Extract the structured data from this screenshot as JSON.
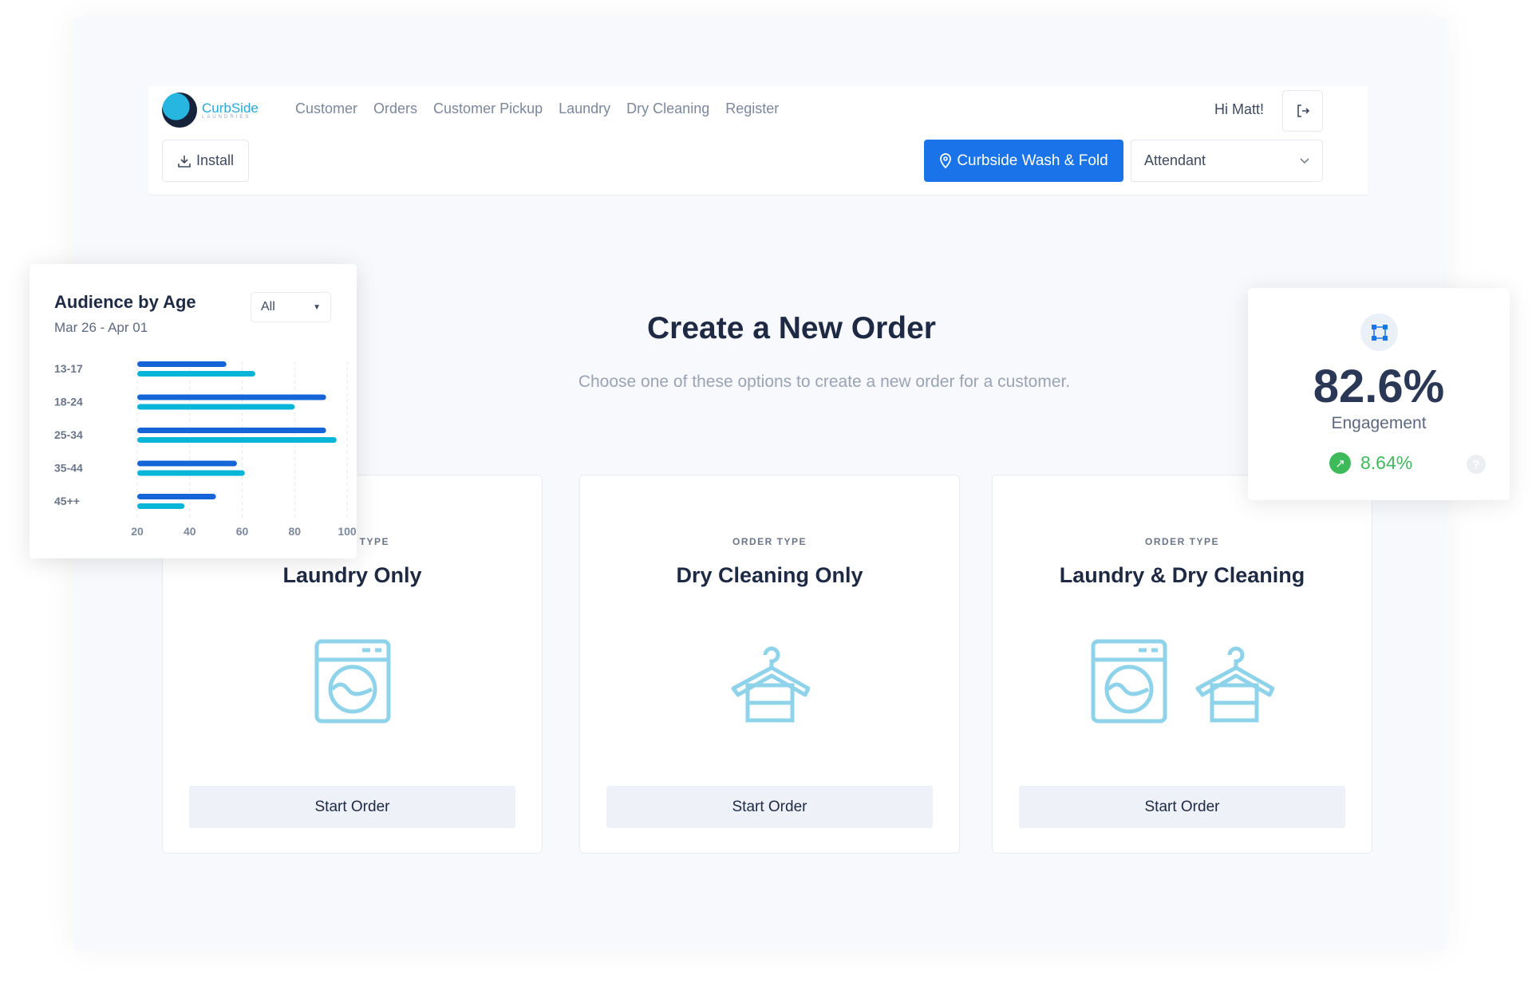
{
  "logo": {
    "name": "CurbSide",
    "tagline": "LAUNDRIES"
  },
  "nav": [
    "Customer",
    "Orders",
    "Customer Pickup",
    "Laundry",
    "Dry Cleaning",
    "Register"
  ],
  "header": {
    "install_label": "Install",
    "greeting": "Hi Matt!",
    "location_label": "Curbside Wash & Fold",
    "role_value": "Attendant"
  },
  "main": {
    "title": "Create a New Order",
    "subtitle": "Choose one of these options to create a new order for a customer.",
    "cards": [
      {
        "type_label": "ORDER TYPE",
        "title": "Laundry Only",
        "button": "Start Order",
        "icons": [
          "washing-machine"
        ]
      },
      {
        "type_label": "ORDER TYPE",
        "title": "Dry Cleaning Only",
        "button": "Start Order",
        "icons": [
          "hanger"
        ]
      },
      {
        "type_label": "ORDER TYPE",
        "title": "Laundry & Dry Cleaning",
        "button": "Start Order",
        "icons": [
          "washing-machine",
          "hanger"
        ]
      }
    ]
  },
  "chart_data": {
    "type": "bar",
    "orientation": "horizontal",
    "title": "Audience by Age",
    "subtitle": "Mar 26 - Apr 01",
    "filter": "All",
    "categories": [
      "13-17",
      "18-24",
      "25-34",
      "35-44",
      "45++"
    ],
    "series": [
      {
        "values": [
          54,
          92,
          92,
          58,
          50
        ],
        "color": "#1565d8"
      },
      {
        "values": [
          65,
          80,
          96,
          61,
          38
        ],
        "color": "#07b5d8"
      }
    ],
    "xticks": [
      20,
      40,
      60,
      80,
      100
    ],
    "xlim": [
      20,
      100
    ],
    "grid": "vertical dashed"
  },
  "engagement": {
    "value": "82.6%",
    "label": "Engagement",
    "change": "8.64%",
    "trend": "up"
  },
  "colors": {
    "accent": "#1a73e8",
    "icon": "#8fd3ea",
    "positive": "#3dbb5b"
  }
}
